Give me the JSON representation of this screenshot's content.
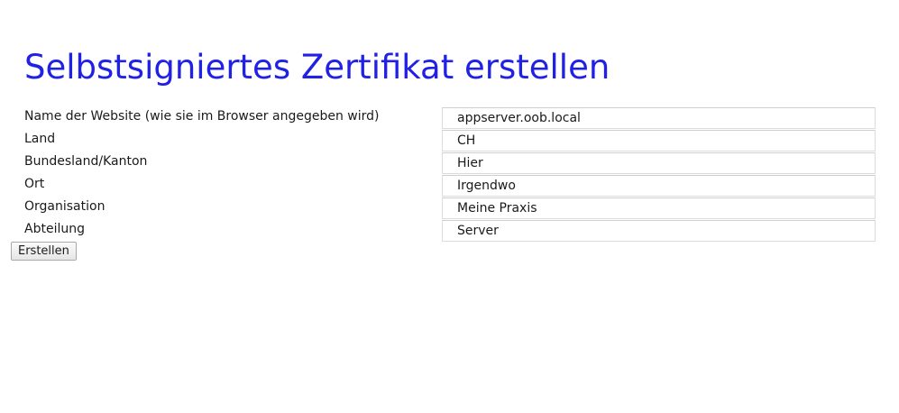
{
  "page": {
    "title": "Selbstsigniertes Zertifikat erstellen"
  },
  "form": {
    "fields": [
      {
        "label": "Name der Website (wie sie im Browser angegeben wird)",
        "value": "appserver.oob.local"
      },
      {
        "label": "Land",
        "value": "CH"
      },
      {
        "label": "Bundesland/Kanton",
        "value": "Hier"
      },
      {
        "label": "Ort",
        "value": "Irgendwo"
      },
      {
        "label": "Organisation",
        "value": "Meine Praxis"
      },
      {
        "label": "Abteilung",
        "value": "Server"
      }
    ],
    "submit_label": "Erstellen"
  },
  "colors": {
    "title": "#2121e6",
    "text": "#1a1a1a",
    "input_border": "#dcdcdc"
  }
}
